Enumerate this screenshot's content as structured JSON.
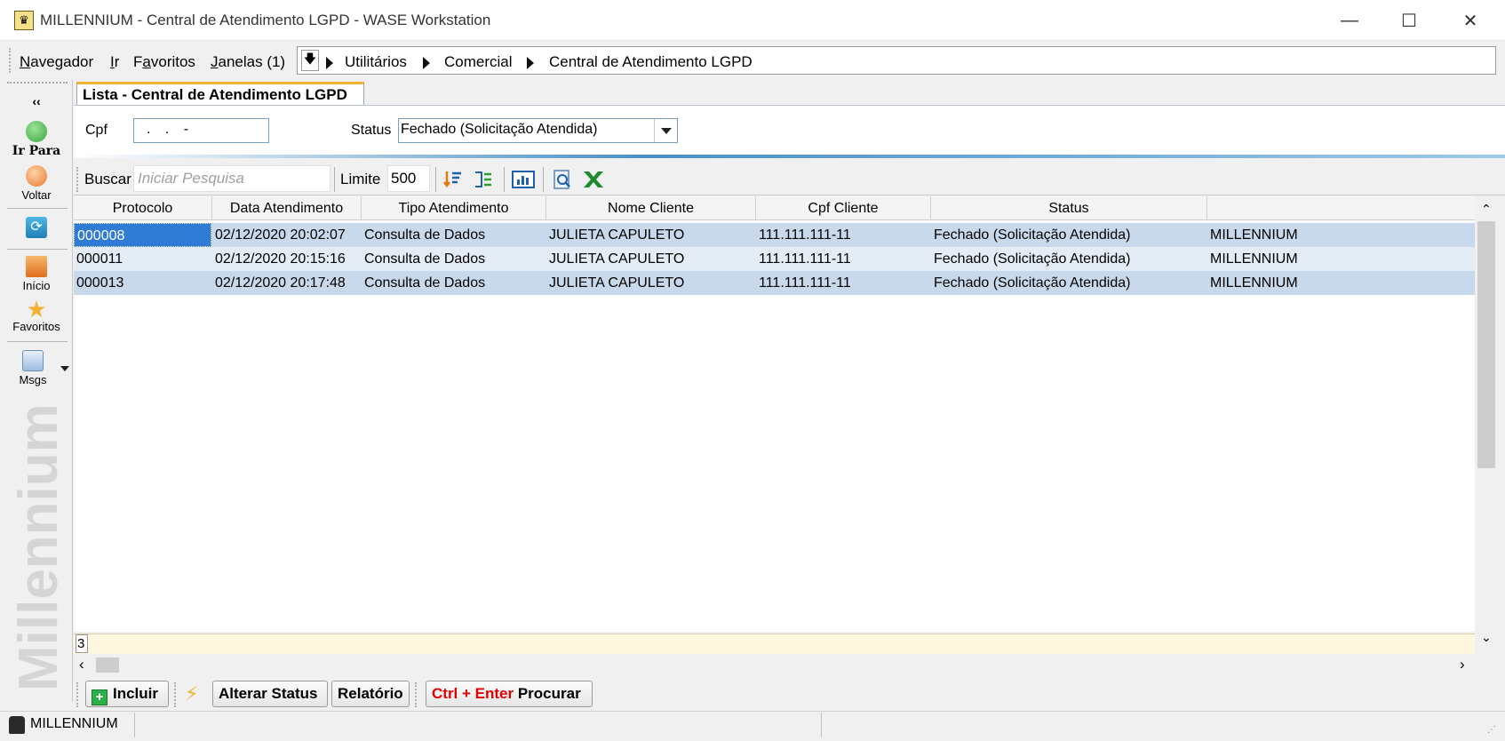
{
  "window": {
    "title": "MILLENNIUM - Central de Atendimento LGPD - WASE Workstation",
    "minimize": "—",
    "maximize": "☐",
    "close": "✕"
  },
  "menu": {
    "items": [
      {
        "underline": "N",
        "rest": "avegador"
      },
      {
        "underline": "I",
        "rest": "r"
      },
      {
        "underline": "F",
        "rest": "avoritos",
        "prefix": ""
      },
      {
        "underline": "J",
        "rest": "anelas (1)"
      }
    ],
    "favoritos_prefix": "F",
    "favoritos_underline": "a",
    "favoritos_rest": "voritos"
  },
  "breadcrumb": [
    "Utilitários",
    "Comercial",
    "Central de Atendimento LGPD"
  ],
  "sidebar": {
    "collapse": "‹‹",
    "ir_para": "Ir Para",
    "voltar": "Voltar",
    "inicio": "Início",
    "favoritos": "Favoritos",
    "msgs": "Msgs",
    "brand": "Millennium"
  },
  "tab": {
    "label": "Lista - Central de Atendimento LGPD"
  },
  "filters": {
    "cpf_label": "Cpf",
    "cpf_value": ". . -",
    "status_label": "Status",
    "status_value": "Fechado (Solicitação Atendida)"
  },
  "toolbar": {
    "buscar_label": "Buscar",
    "buscar_placeholder": "Iniciar Pesquisa",
    "limite_label": "Limite",
    "limite_value": "500"
  },
  "grid": {
    "columns": [
      "Protocolo",
      "Data Atendimento",
      "Tipo Atendimento",
      "Nome Cliente",
      "Cpf Cliente",
      "Status",
      ""
    ],
    "rows": [
      [
        "000008",
        "02/12/2020 20:02:07",
        "Consulta de Dados",
        "JULIETA CAPULETO",
        "111.111.111-11",
        "Fechado (Solicitação Atendida)",
        "MILLENNIUM"
      ],
      [
        "000011",
        "02/12/2020 20:15:16",
        "Consulta de Dados",
        "JULIETA CAPULETO",
        "111.111.111-11",
        "Fechado (Solicitação Atendida)",
        "MILLENNIUM"
      ],
      [
        "000013",
        "02/12/2020 20:17:48",
        "Consulta de Dados",
        "JULIETA CAPULETO",
        "111.111.111-11",
        "Fechado (Solicitação Atendida)",
        "MILLENNIUM"
      ]
    ],
    "count": "3"
  },
  "actions": {
    "incluir": "Incluir",
    "alterar_status": "Alterar Status",
    "relatorio": "Relatório",
    "procurar_shortcut": "Ctrl + Enter",
    "procurar": "Procurar"
  },
  "statusbar": {
    "user": "MILLENNIUM"
  },
  "colors": {
    "selection": "#2f7bd6",
    "row_odd": "#c9d9ec",
    "row_even": "#e4ecf5",
    "tab_accent": "#f2b330",
    "shortcut_red": "#e00000"
  }
}
